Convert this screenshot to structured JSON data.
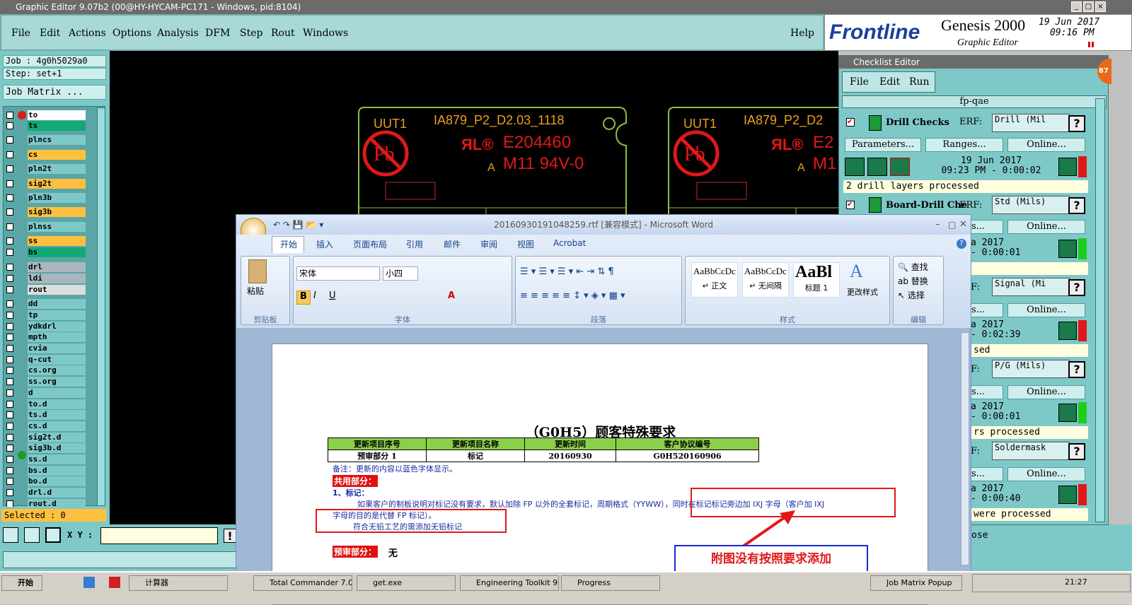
{
  "titlebar": {
    "title": "Graphic Editor 9.07b2 (00@HY-HYCAM-PC171 - Windows, pid:8104)"
  },
  "menu": {
    "items": [
      "File",
      "Edit",
      "Actions",
      "Options",
      "Analysis",
      "DFM",
      "Step",
      "Rout",
      "Windows"
    ],
    "help": "Help"
  },
  "brand": {
    "logo": "Frontline",
    "product": "Genesis 2000",
    "subtitle": "Graphic Editor",
    "date": "19 Jun 2017",
    "time": "09:16 PM"
  },
  "job": {
    "job": "Job : 4g0h5029a0",
    "step": "Step: set+1",
    "matrix_btn": "Job Matrix ...",
    "selected": "Selected : 0",
    "xy_label": "X Y :"
  },
  "layers": [
    {
      "name": "to",
      "color": "#ffffff"
    },
    {
      "name": "ts",
      "color": "#11aa77"
    },
    {
      "name": "plncs",
      "color": "#7fc8c8"
    },
    {
      "name": "cs",
      "color": "#ffc040"
    },
    {
      "name": "pln2t",
      "color": "#7fc8c8"
    },
    {
      "name": "sig2t",
      "color": "#ffc040"
    },
    {
      "name": "pln3b",
      "color": "#7fc8c8"
    },
    {
      "name": "sig3b",
      "color": "#ffc040"
    },
    {
      "name": "plnss",
      "color": "#7fc8c8"
    },
    {
      "name": "ss",
      "color": "#ffc040"
    },
    {
      "name": "bs",
      "color": "#11aa77"
    },
    {
      "name": "drl",
      "color": "#a9b8c0"
    },
    {
      "name": "ldi",
      "color": "#a9b8c0"
    },
    {
      "name": "rout",
      "color": "#dddddd"
    },
    {
      "name": "dd",
      "color": "#7fc8c8"
    },
    {
      "name": "tp",
      "color": "#7fc8c8"
    },
    {
      "name": "ydkdrl",
      "color": "#7fc8c8"
    },
    {
      "name": "mpth",
      "color": "#7fc8c8"
    },
    {
      "name": "cvia",
      "color": "#7fc8c8"
    },
    {
      "name": "q-cut",
      "color": "#7fc8c8"
    },
    {
      "name": "cs.org",
      "color": "#7fc8c8"
    },
    {
      "name": "ss.org",
      "color": "#7fc8c8"
    },
    {
      "name": "d",
      "color": "#7fc8c8"
    },
    {
      "name": "to.d",
      "color": "#7fc8c8"
    },
    {
      "name": "ts.d",
      "color": "#7fc8c8"
    },
    {
      "name": "cs.d",
      "color": "#7fc8c8"
    },
    {
      "name": "sig2t.d",
      "color": "#7fc8c8"
    },
    {
      "name": "sig3b.d",
      "color": "#7fc8c8"
    },
    {
      "name": "ss.d",
      "color": "#7fc8c8"
    },
    {
      "name": "bs.d",
      "color": "#7fc8c8"
    },
    {
      "name": "bo.d",
      "color": "#7fc8c8"
    },
    {
      "name": "drl.d",
      "color": "#7fc8c8"
    },
    {
      "name": "rout.d",
      "color": "#7fc8c8"
    }
  ],
  "pcb": {
    "uut": "UUT1",
    "part": "IA879_P2_D2.03_1118",
    "part_cut": "IA879_P2_D2",
    "ul": "E204460",
    "ul_cut": "E2",
    "rating": "M11 94V-0",
    "rating_cut": "M1",
    "a": "A"
  },
  "checklist": {
    "title": "Checklist Editor",
    "menu": [
      "File",
      "Edit",
      "Run"
    ],
    "name": "fp-qae",
    "badge": "87",
    "erf": "ERF:",
    "params": "Parameters...",
    "ranges": "Ranges...",
    "online": "Online...",
    "c1": {
      "name": "Drill Checks",
      "erf_val": "Drill (Mil",
      "date": "19 Jun 2017",
      "time": "09:23 PM - 0:00:02",
      "status": "2 drill layers processed"
    },
    "c2": {
      "name": "Board-Drill Che",
      "erf_val": "Std (Mils)",
      "date": "a 2017",
      "time": "- 0:00:01",
      "status": ""
    },
    "c3": {
      "erf_val": "Signal (Mi",
      "date": "a 2017",
      "time": "- 0:02:39",
      "status": "sed"
    },
    "c4": {
      "erf_val": "P/G (Mils)",
      "date": "a 2017",
      "time": "- 0:00:01",
      "status": "rs processed"
    },
    "c5": {
      "erf_val": "Soldermask",
      "date": "a 2017",
      "time": "- 0:00:40",
      "status": " were processed"
    },
    "ellipsis": "s...",
    "close_frag": "ose",
    "f_frag": "F:"
  },
  "word": {
    "title": "20160930191048259.rtf [兼容模式] - Microsoft Word",
    "tabs": [
      "开始",
      "插入",
      "页面布局",
      "引用",
      "邮件",
      "审阅",
      "视图",
      "Acrobat"
    ],
    "font": "宋体",
    "size": "小四",
    "groups": [
      "剪贴板",
      "字体",
      "段落",
      "样式",
      "编辑"
    ],
    "paste": "粘贴",
    "styles": [
      {
        "preview": "AaBbCcDc",
        "name": "↵ 正文"
      },
      {
        "preview": "AaBbCcDc",
        "name": "↵ 无间隔"
      },
      {
        "preview": "AaBl",
        "name": "标题 1"
      }
    ],
    "change_styles": "更改样式",
    "edit": [
      "查找",
      "替换",
      "选择"
    ],
    "doc": {
      "heading": "（G0H5）顾客特殊要求",
      "table_headers": [
        "更新项目序号",
        "更新项目名称",
        "更新时间",
        "客户协议编号"
      ],
      "table_row": [
        "预审部分 1",
        "标记",
        "20160930",
        "G0H520160906"
      ],
      "note": "备注：更新的内容以蓝色字体显示。",
      "shared": "共用部分：",
      "item1": "1、标记：",
      "para1": "如果客户的制板说明对标记没有要求，默认加除 FP 以外的全套标记，周期格式（YYWW），同时在标记标记旁边加 IXJ 字母（客户加 IXJ",
      "para2": "字母的目的是代替 FP 标记）。",
      "para3": "符合无铅工艺的需添加无铅标记",
      "pre": "预审部分：",
      "none": "无"
    },
    "annotation": "附图没有按照要求添加"
  },
  "taskbar": {
    "start": "开始",
    "tasks": [
      "计算器",
      "Total Commander 7.0 ...",
      "get.exe",
      "Engineering Toolkit 9....",
      "Progress",
      "Job Matrix Popup"
    ],
    "clock": "21:27"
  }
}
